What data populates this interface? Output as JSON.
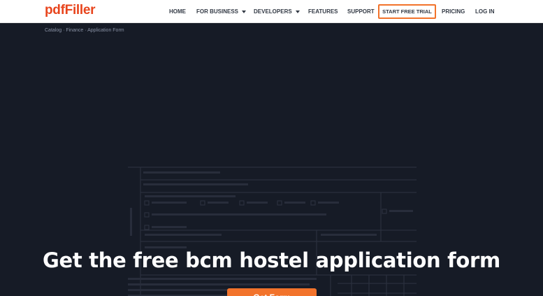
{
  "header": {
    "logo": {
      "part1": "pdf",
      "part2": "Filler"
    },
    "nav": {
      "home": "HOME",
      "for_business": "FOR BUSINESS",
      "developers": "DEVELOPERS",
      "features": "FEATURES",
      "support": "SUPPORT",
      "start_free_trial": "START FREE TRIAL",
      "pricing": "PRICING",
      "log_in": "LOG IN"
    }
  },
  "hero": {
    "breadcrumb": "Catalog · Finance · Application Form",
    "headline": "Get the free bcm hostel application form",
    "cta_label": "Get Form"
  },
  "colors": {
    "brand": "#e8451d",
    "accent": "#f2732b",
    "hero_bg": "#161b26"
  }
}
